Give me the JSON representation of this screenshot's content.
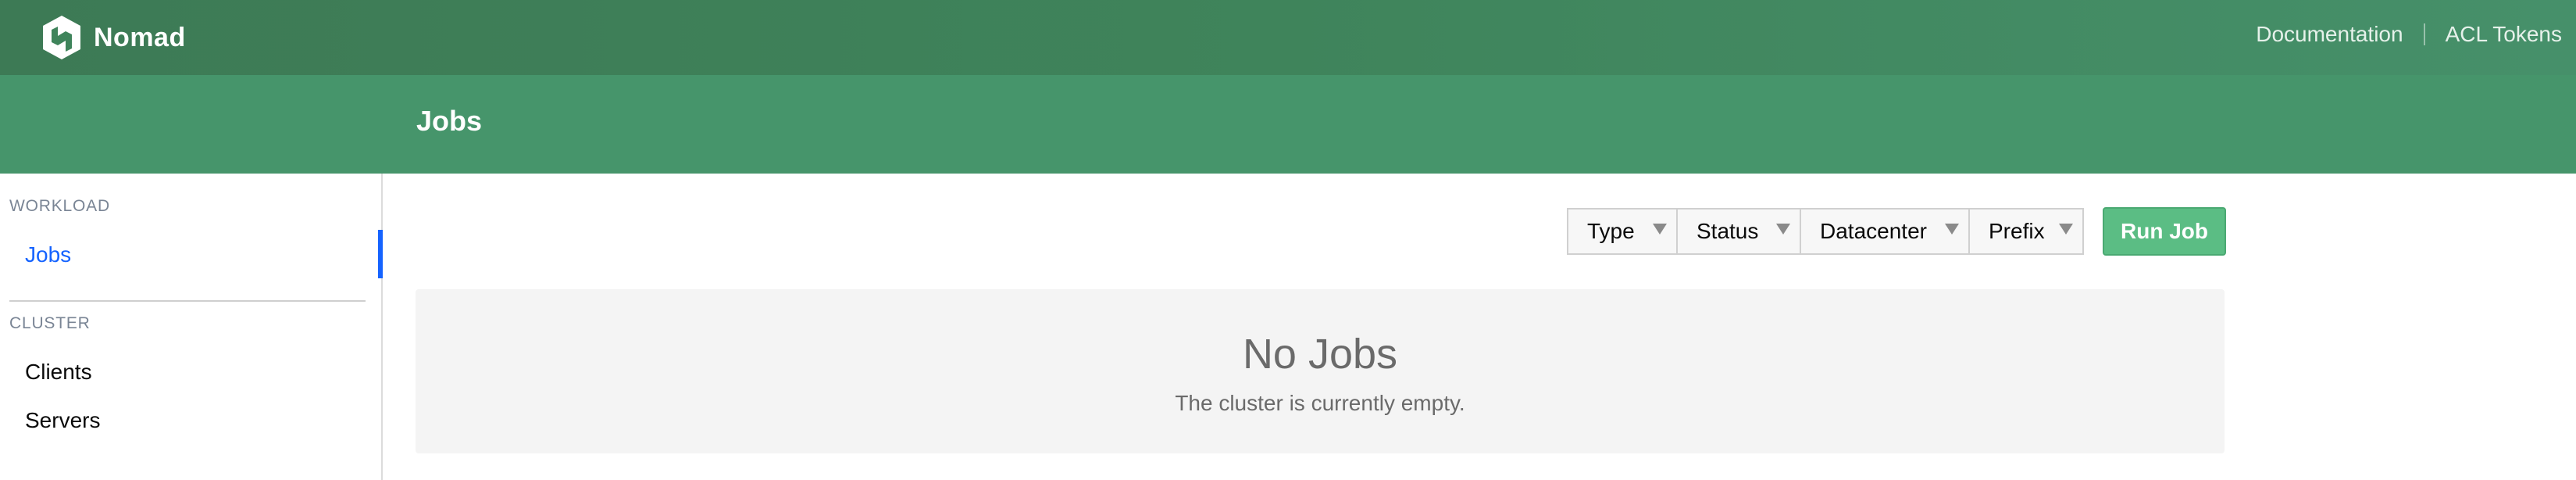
{
  "app": {
    "name": "Nomad",
    "logo_icon": "nomad-logo-icon"
  },
  "topnav": {
    "documentation": "Documentation",
    "acl_tokens": "ACL Tokens"
  },
  "page": {
    "title": "Jobs"
  },
  "sidebar": {
    "sections": [
      {
        "label": "WORKLOAD",
        "items": [
          {
            "label": "Jobs",
            "active": true
          }
        ]
      },
      {
        "label": "CLUSTER",
        "items": [
          {
            "label": "Clients",
            "active": false
          },
          {
            "label": "Servers",
            "active": false
          }
        ]
      }
    ]
  },
  "toolbar": {
    "facets": [
      {
        "label": "Type",
        "icon": "caret-down-icon"
      },
      {
        "label": "Status",
        "icon": "caret-down-icon"
      },
      {
        "label": "Datacenter",
        "icon": "caret-down-icon"
      },
      {
        "label": "Prefix",
        "icon": "caret-down-icon"
      }
    ],
    "run_job": "Run Job"
  },
  "empty_state": {
    "title": "No Jobs",
    "message": "The cluster is currently empty."
  },
  "colors": {
    "brand_green": "#3f845b",
    "subheader_green": "#46956b",
    "run_button": "#5bbd84",
    "active_link": "#1563ff"
  }
}
